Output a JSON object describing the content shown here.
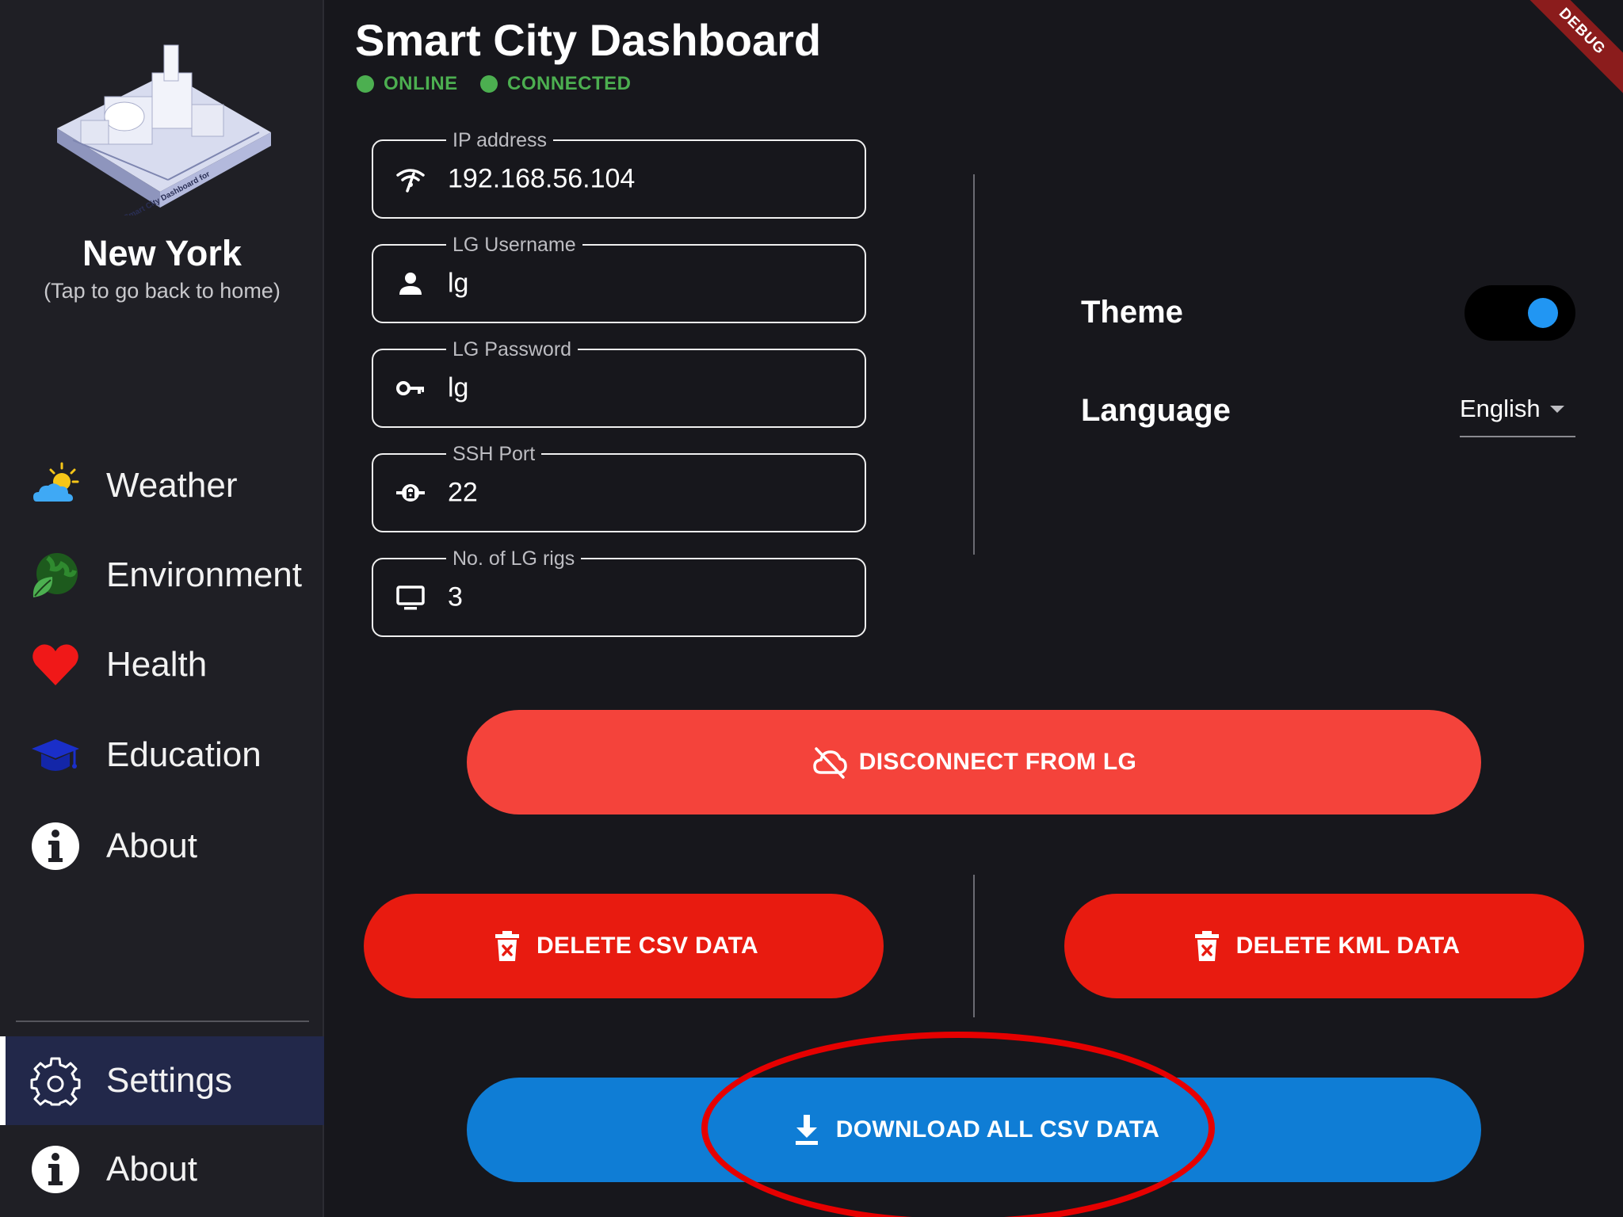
{
  "header": {
    "title": "Smart City Dashboard",
    "status_online": "ONLINE",
    "status_connected": "CONNECTED",
    "debug_label": "DEBUG"
  },
  "sidebar": {
    "city_name": "New York",
    "city_hint": "(Tap to go back to home)",
    "logo_text": "Smart City Dashboard for",
    "items": [
      {
        "label": "Weather",
        "icon": "weather-icon"
      },
      {
        "label": "Environment",
        "icon": "environment-icon"
      },
      {
        "label": "Health",
        "icon": "heart-icon"
      },
      {
        "label": "Education",
        "icon": "graduation-cap-icon"
      },
      {
        "label": "About",
        "icon": "info-icon"
      }
    ],
    "bottom_items": [
      {
        "label": "Settings",
        "icon": "gear-icon",
        "active": true
      },
      {
        "label": "About",
        "icon": "info-icon"
      }
    ]
  },
  "form": {
    "ip": {
      "label": "IP address",
      "value": "192.168.56.104",
      "icon": "wifi-icon"
    },
    "username": {
      "label": "LG Username",
      "value": "lg",
      "icon": "person-icon"
    },
    "password": {
      "label": "LG Password",
      "value": "lg",
      "icon": "key-icon"
    },
    "port": {
      "label": "SSH Port",
      "value": "22",
      "icon": "lock-icon"
    },
    "rigs": {
      "label": "No. of LG rigs",
      "value": "3",
      "icon": "monitor-icon"
    }
  },
  "settings": {
    "theme_label": "Theme",
    "theme_on": true,
    "language_label": "Language",
    "language_value": "English"
  },
  "buttons": {
    "disconnect": "DISCONNECT FROM LG",
    "delete_csv": "DELETE CSV DATA",
    "delete_kml": "DELETE KML DATA",
    "download_csv": "DOWNLOAD ALL CSV DATA"
  },
  "colors": {
    "background": "#17171c",
    "sidebar": "#1f1f25",
    "online_green": "#4caf50",
    "disconnect_red": "#f4433b",
    "delete_red": "#e81b10",
    "download_blue": "#0f7dd5",
    "toggle_blue": "#2196f3",
    "highlight_red": "#e60000"
  }
}
